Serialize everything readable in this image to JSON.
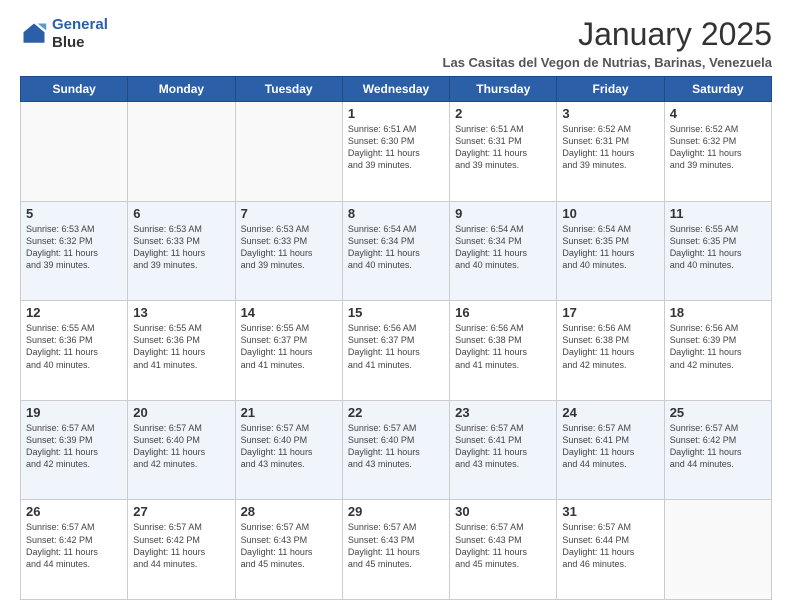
{
  "logo": {
    "line1": "General",
    "line2": "Blue"
  },
  "title": "January 2025",
  "location": "Las Casitas del Vegon de Nutrias, Barinas, Venezuela",
  "days_header": [
    "Sunday",
    "Monday",
    "Tuesday",
    "Wednesday",
    "Thursday",
    "Friday",
    "Saturday"
  ],
  "weeks": [
    [
      {
        "day": "",
        "info": ""
      },
      {
        "day": "",
        "info": ""
      },
      {
        "day": "",
        "info": ""
      },
      {
        "day": "1",
        "info": "Sunrise: 6:51 AM\nSunset: 6:30 PM\nDaylight: 11 hours\nand 39 minutes."
      },
      {
        "day": "2",
        "info": "Sunrise: 6:51 AM\nSunset: 6:31 PM\nDaylight: 11 hours\nand 39 minutes."
      },
      {
        "day": "3",
        "info": "Sunrise: 6:52 AM\nSunset: 6:31 PM\nDaylight: 11 hours\nand 39 minutes."
      },
      {
        "day": "4",
        "info": "Sunrise: 6:52 AM\nSunset: 6:32 PM\nDaylight: 11 hours\nand 39 minutes."
      }
    ],
    [
      {
        "day": "5",
        "info": "Sunrise: 6:53 AM\nSunset: 6:32 PM\nDaylight: 11 hours\nand 39 minutes."
      },
      {
        "day": "6",
        "info": "Sunrise: 6:53 AM\nSunset: 6:33 PM\nDaylight: 11 hours\nand 39 minutes."
      },
      {
        "day": "7",
        "info": "Sunrise: 6:53 AM\nSunset: 6:33 PM\nDaylight: 11 hours\nand 39 minutes."
      },
      {
        "day": "8",
        "info": "Sunrise: 6:54 AM\nSunset: 6:34 PM\nDaylight: 11 hours\nand 40 minutes."
      },
      {
        "day": "9",
        "info": "Sunrise: 6:54 AM\nSunset: 6:34 PM\nDaylight: 11 hours\nand 40 minutes."
      },
      {
        "day": "10",
        "info": "Sunrise: 6:54 AM\nSunset: 6:35 PM\nDaylight: 11 hours\nand 40 minutes."
      },
      {
        "day": "11",
        "info": "Sunrise: 6:55 AM\nSunset: 6:35 PM\nDaylight: 11 hours\nand 40 minutes."
      }
    ],
    [
      {
        "day": "12",
        "info": "Sunrise: 6:55 AM\nSunset: 6:36 PM\nDaylight: 11 hours\nand 40 minutes."
      },
      {
        "day": "13",
        "info": "Sunrise: 6:55 AM\nSunset: 6:36 PM\nDaylight: 11 hours\nand 41 minutes."
      },
      {
        "day": "14",
        "info": "Sunrise: 6:55 AM\nSunset: 6:37 PM\nDaylight: 11 hours\nand 41 minutes."
      },
      {
        "day": "15",
        "info": "Sunrise: 6:56 AM\nSunset: 6:37 PM\nDaylight: 11 hours\nand 41 minutes."
      },
      {
        "day": "16",
        "info": "Sunrise: 6:56 AM\nSunset: 6:38 PM\nDaylight: 11 hours\nand 41 minutes."
      },
      {
        "day": "17",
        "info": "Sunrise: 6:56 AM\nSunset: 6:38 PM\nDaylight: 11 hours\nand 42 minutes."
      },
      {
        "day": "18",
        "info": "Sunrise: 6:56 AM\nSunset: 6:39 PM\nDaylight: 11 hours\nand 42 minutes."
      }
    ],
    [
      {
        "day": "19",
        "info": "Sunrise: 6:57 AM\nSunset: 6:39 PM\nDaylight: 11 hours\nand 42 minutes."
      },
      {
        "day": "20",
        "info": "Sunrise: 6:57 AM\nSunset: 6:40 PM\nDaylight: 11 hours\nand 42 minutes."
      },
      {
        "day": "21",
        "info": "Sunrise: 6:57 AM\nSunset: 6:40 PM\nDaylight: 11 hours\nand 43 minutes."
      },
      {
        "day": "22",
        "info": "Sunrise: 6:57 AM\nSunset: 6:40 PM\nDaylight: 11 hours\nand 43 minutes."
      },
      {
        "day": "23",
        "info": "Sunrise: 6:57 AM\nSunset: 6:41 PM\nDaylight: 11 hours\nand 43 minutes."
      },
      {
        "day": "24",
        "info": "Sunrise: 6:57 AM\nSunset: 6:41 PM\nDaylight: 11 hours\nand 44 minutes."
      },
      {
        "day": "25",
        "info": "Sunrise: 6:57 AM\nSunset: 6:42 PM\nDaylight: 11 hours\nand 44 minutes."
      }
    ],
    [
      {
        "day": "26",
        "info": "Sunrise: 6:57 AM\nSunset: 6:42 PM\nDaylight: 11 hours\nand 44 minutes."
      },
      {
        "day": "27",
        "info": "Sunrise: 6:57 AM\nSunset: 6:42 PM\nDaylight: 11 hours\nand 44 minutes."
      },
      {
        "day": "28",
        "info": "Sunrise: 6:57 AM\nSunset: 6:43 PM\nDaylight: 11 hours\nand 45 minutes."
      },
      {
        "day": "29",
        "info": "Sunrise: 6:57 AM\nSunset: 6:43 PM\nDaylight: 11 hours\nand 45 minutes."
      },
      {
        "day": "30",
        "info": "Sunrise: 6:57 AM\nSunset: 6:43 PM\nDaylight: 11 hours\nand 45 minutes."
      },
      {
        "day": "31",
        "info": "Sunrise: 6:57 AM\nSunset: 6:44 PM\nDaylight: 11 hours\nand 46 minutes."
      },
      {
        "day": "",
        "info": ""
      }
    ]
  ]
}
